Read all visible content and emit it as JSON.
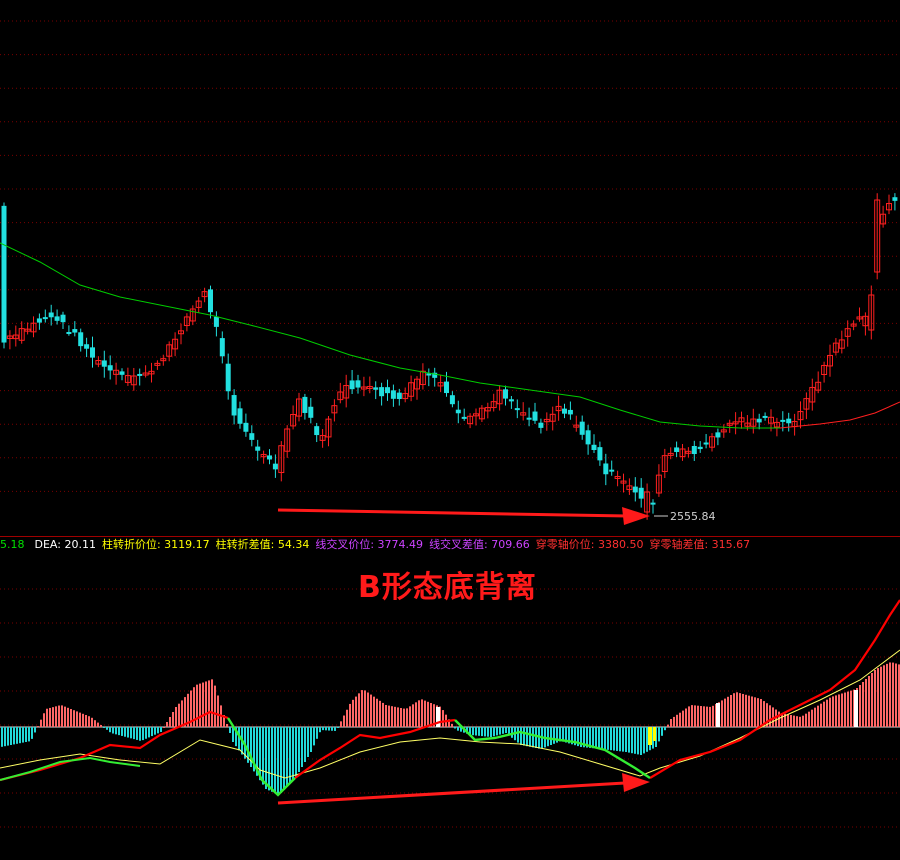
{
  "annotation": {
    "title": "B形态底背离",
    "low_price_label": "2555.84"
  },
  "indicator_bar": {
    "items": [
      {
        "label": "5.18",
        "color": "#00e000"
      },
      {
        "label": "DEA: 20.11",
        "color": "#ffffff"
      },
      {
        "label": "柱转折价位: 3119.17",
        "color": "#ffff00"
      },
      {
        "label": "柱转折差值: 54.34",
        "color": "#ffff00"
      },
      {
        "label": "线交叉价位: 3774.49",
        "color": "#cc44ff"
      },
      {
        "label": "线交叉差值: 709.66",
        "color": "#cc44ff"
      },
      {
        "label": "穿零轴价位: 3380.50",
        "color": "#ff3030"
      },
      {
        "label": "穿零轴差值: 315.67",
        "color": "#ff3030"
      }
    ]
  },
  "colors": {
    "up": "#ff2020",
    "down": "#22e0e0",
    "ma_above": "#00cc00",
    "ma_below": "#ff2020",
    "grid": "#7a0000",
    "arrow": "#ff1a1a",
    "dif": "#ff0000",
    "dea": "#ffff66"
  },
  "chart_data": [
    {
      "type": "candlestick",
      "title": "",
      "annotations": [
        "2555.84"
      ],
      "series": [
        {
          "name": "",
          "kind": "candles"
        },
        {
          "name": "",
          "kind": "moving-average"
        }
      ]
    },
    {
      "type": "bar",
      "title": "",
      "annotations": [
        "B形态底背离"
      ],
      "series": [
        {
          "name": "",
          "kind": "macd-histogram"
        },
        {
          "name": "",
          "kind": "dif-line"
        },
        {
          "name": "DEA",
          "kind": "dea-line",
          "last_value": 20.11
        }
      ]
    }
  ]
}
